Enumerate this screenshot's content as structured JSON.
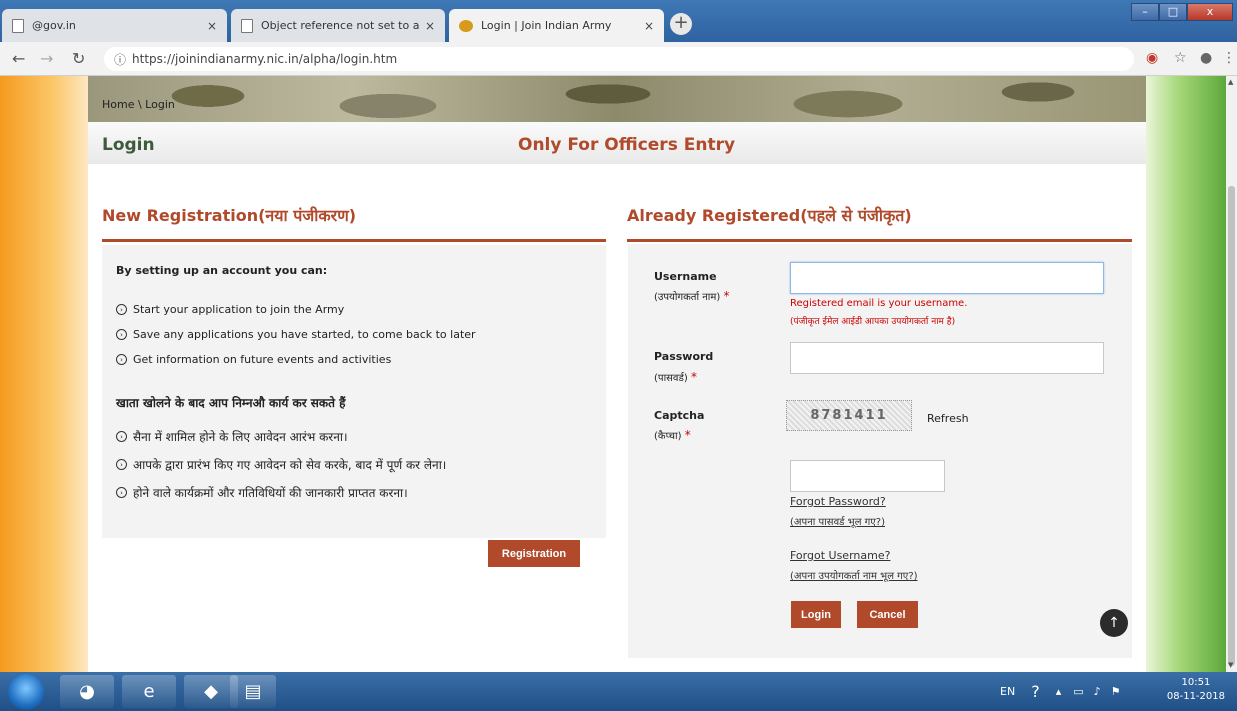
{
  "browser": {
    "tabs": [
      {
        "title": "@gov.in",
        "close": "×"
      },
      {
        "title": "Object reference not set to an in",
        "close": "×"
      },
      {
        "title": "Login | Join Indian Army",
        "close": "×"
      }
    ],
    "new_tab": "+",
    "window_buttons": {
      "minimize": "–",
      "maximize": "□",
      "close": "x"
    },
    "url": "https://joinindianarmy.nic.in/alpha/login.htm"
  },
  "breadcrumb": "Home \\ Login",
  "header": {
    "title": "Login",
    "entry_note": "Only For Officers Entry"
  },
  "new_registration": {
    "heading": "New Registration(नया पंजीकरण)",
    "intro_en": "By setting up an account you can:",
    "bullets_en": [
      "Start your application to join the Army",
      "Save any applications you have started, to come back to later",
      "Get information on future events and activities"
    ],
    "intro_hi": "खाता खोलने के बाद आप निम्नऔ कार्य कर सकते हैं",
    "bullets_hi": [
      "सैना में शामिल होने के लिए आवेदन आरंभ करना।",
      "आपके द्वारा प्रारंभ किए गए आवेदन को सेव करके, बाद में पूर्ण कर लेना।",
      "होने वाले कार्यक्रमों और गतिविधियों की जानकारी प्राप्तत करना।"
    ],
    "button": "Registration"
  },
  "login_form": {
    "heading": "Already Registered(पहले से पंजीकृत)",
    "username_label": "Username",
    "username_label_hi": "(उपयोगकर्ता नाम)",
    "username_value": "",
    "username_hint": "Registered email is your username.",
    "username_hint_hi": "(पंजीकृत ईमेल आईडी आपका उपयोगकर्ता नाम है)",
    "password_label": "Password",
    "password_label_hi": "(पासवर्ड)",
    "password_value": "",
    "captcha_label": "Captcha",
    "captcha_label_hi": "(कैप्चा)",
    "captcha_text": "8781411",
    "refresh": "Refresh",
    "captcha_value": "",
    "required_mark": "*",
    "forgot_password": "Forgot Password?",
    "forgot_password_hi": "(अपना पासवर्ड भूल गए?)",
    "forgot_username": "Forgot Username?",
    "forgot_username_hi": "(अपना उपयोगकर्ता नाम भूल गए?)",
    "login_button": "Login",
    "cancel_button": "Cancel"
  },
  "taskbar": {
    "language": "EN",
    "time": "10:51",
    "date": "08-11-2018"
  }
}
